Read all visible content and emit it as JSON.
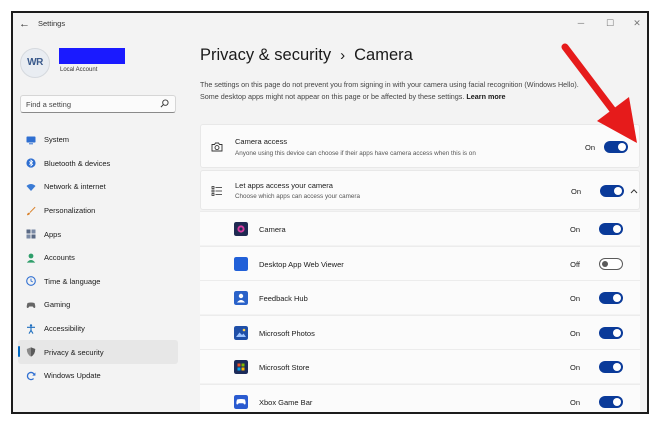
{
  "window": {
    "title": "Settings",
    "minimize": "─",
    "maximize": "☐",
    "close": "✕"
  },
  "user": {
    "initials": "WR",
    "account_type": "Local Account"
  },
  "search": {
    "placeholder": "Find a setting"
  },
  "sidebar": {
    "items": [
      {
        "label": "System",
        "icon": "system-icon",
        "color": "#2f6fd1"
      },
      {
        "label": "Bluetooth & devices",
        "icon": "bluetooth-icon",
        "color": "#2f6fd1"
      },
      {
        "label": "Network & internet",
        "icon": "wifi-icon",
        "color": "#3a7bd5"
      },
      {
        "label": "Personalization",
        "icon": "brush-icon",
        "color": "#d9822b"
      },
      {
        "label": "Apps",
        "icon": "apps-icon",
        "color": "#5a6a85"
      },
      {
        "label": "Accounts",
        "icon": "person-icon",
        "color": "#2e9e6a"
      },
      {
        "label": "Time & language",
        "icon": "globe-clock-icon",
        "color": "#2f6fd1"
      },
      {
        "label": "Gaming",
        "icon": "controller-icon",
        "color": "#666666"
      },
      {
        "label": "Accessibility",
        "icon": "accessibility-icon",
        "color": "#1f6fbf"
      },
      {
        "label": "Privacy & security",
        "icon": "shield-icon",
        "color": "#777777"
      },
      {
        "label": "Windows Update",
        "icon": "update-icon",
        "color": "#2f6fd1"
      }
    ],
    "active_index": 9
  },
  "breadcrumb": {
    "parent": "Privacy & security",
    "separator": "›",
    "current": "Camera"
  },
  "description": {
    "text": "The settings on this page do not prevent you from signing in with your camera using facial recognition (Windows Hello). Some desktop apps might not appear on this page or be affected by these settings.",
    "link": "Learn more"
  },
  "camera_access": {
    "title": "Camera access",
    "subtitle": "Anyone using this device can choose if their apps have camera access when this is on",
    "state": "On"
  },
  "let_apps": {
    "title": "Let apps access your camera",
    "subtitle": "Choose which apps can access your camera",
    "state": "On",
    "expanded_icon": "chevron-up-icon"
  },
  "apps": [
    {
      "name": "Camera",
      "state": "On",
      "on": true,
      "icon_color": "#1e2a52",
      "icon": "camera-app-icon"
    },
    {
      "name": "Desktop App Web Viewer",
      "state": "Off",
      "on": false,
      "icon_color": "#2160d8",
      "icon": "web-viewer-icon"
    },
    {
      "name": "Feedback Hub",
      "state": "On",
      "on": true,
      "icon_color": "#2a62c9",
      "icon": "feedback-hub-icon"
    },
    {
      "name": "Microsoft Photos",
      "state": "On",
      "on": true,
      "icon_color": "#1f4fa8",
      "icon": "photos-icon"
    },
    {
      "name": "Microsoft Store",
      "state": "On",
      "on": true,
      "icon_color": "#1c2b5a",
      "icon": "store-icon"
    },
    {
      "name": "Xbox Game Bar",
      "state": "On",
      "on": true,
      "icon_color": "#2a5bd0",
      "icon": "xbox-game-bar-icon"
    }
  ],
  "colors": {
    "toggle_on": "#0a3a99",
    "annotation_arrow": "#e61b1b",
    "accent": "#0067c0"
  }
}
